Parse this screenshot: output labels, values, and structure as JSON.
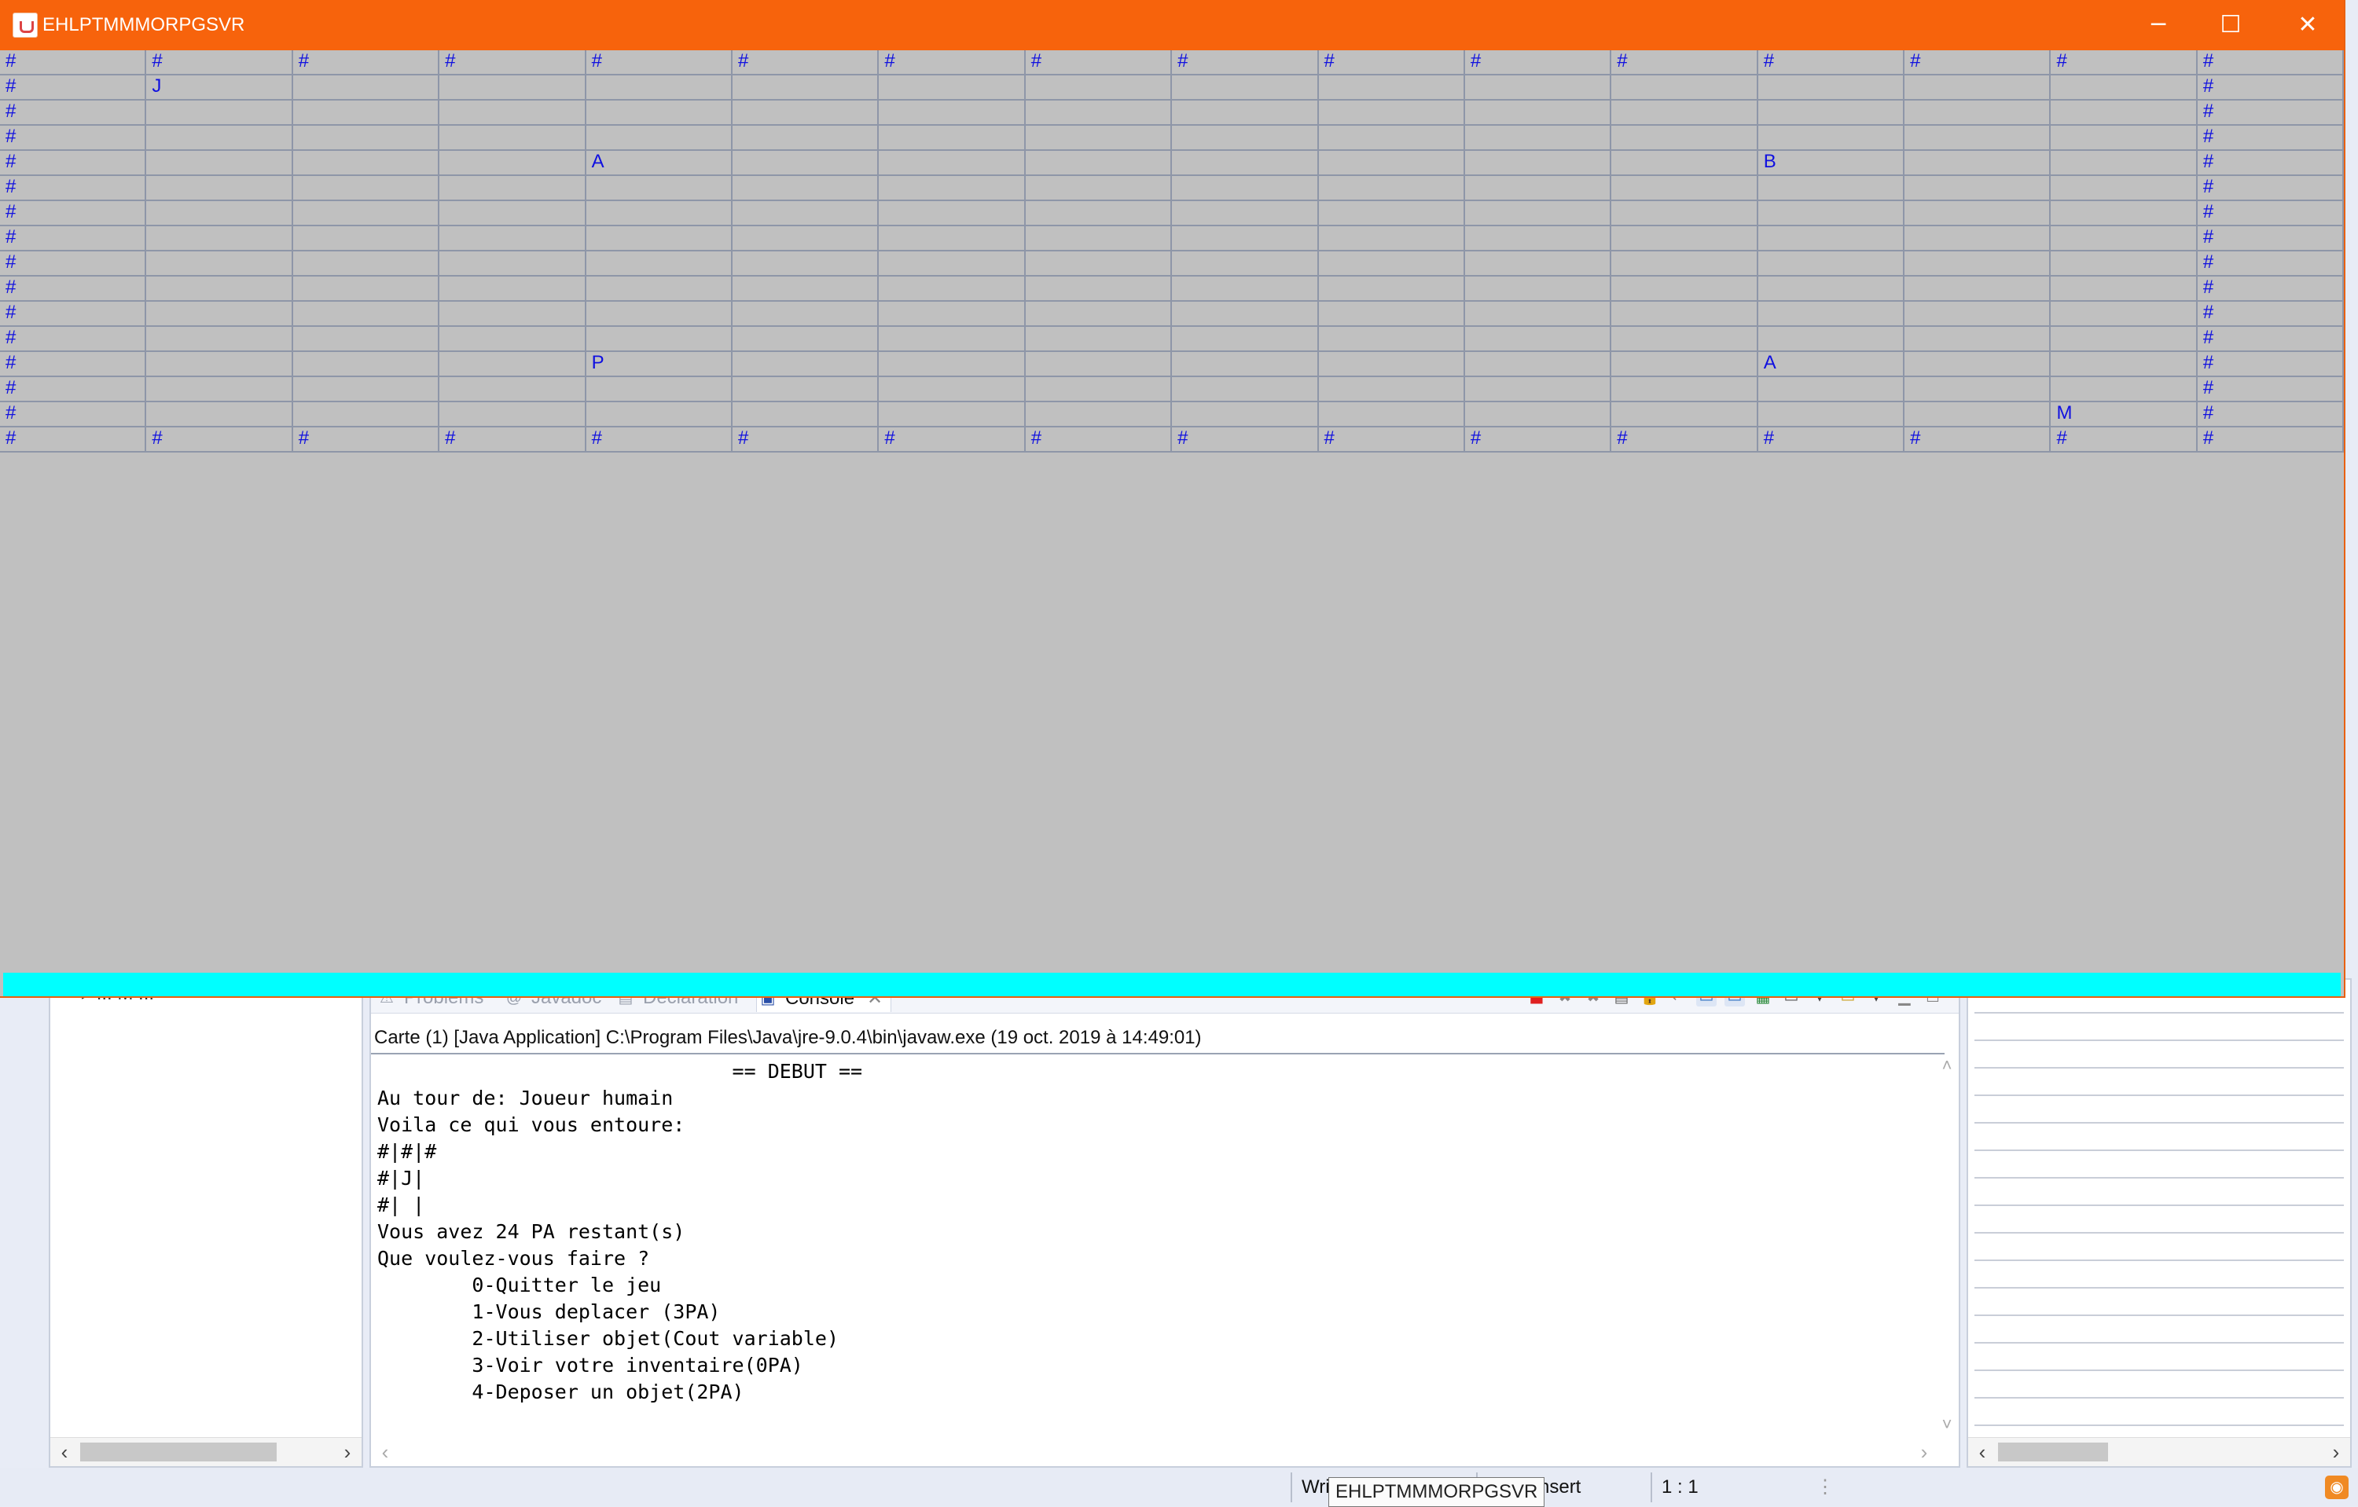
{
  "window": {
    "title": "EHLPTMMMORPGSVR",
    "controls": {
      "minimize": "─",
      "maximize": "☐",
      "close": "✕"
    }
  },
  "map": {
    "rows": [
      [
        "#",
        "#",
        "#",
        "#",
        "#",
        "#",
        "#",
        "#",
        "#",
        "#",
        "#",
        "#",
        "#",
        "#",
        "#",
        "#"
      ],
      [
        "#",
        "J",
        "",
        "",
        "",
        "",
        "",
        "",
        "",
        "",
        "",
        "",
        "",
        "",
        "",
        "#"
      ],
      [
        "#",
        "",
        "",
        "",
        "",
        "",
        "",
        "",
        "",
        "",
        "",
        "",
        "",
        "",
        "",
        "#"
      ],
      [
        "#",
        "",
        "",
        "",
        "",
        "",
        "",
        "",
        "",
        "",
        "",
        "",
        "",
        "",
        "",
        "#"
      ],
      [
        "#",
        "",
        "",
        "",
        "A",
        "",
        "",
        "",
        "",
        "",
        "",
        "",
        "B",
        "",
        "",
        "#"
      ],
      [
        "#",
        "",
        "",
        "",
        "",
        "",
        "",
        "",
        "",
        "",
        "",
        "",
        "",
        "",
        "",
        "#"
      ],
      [
        "#",
        "",
        "",
        "",
        "",
        "",
        "",
        "",
        "",
        "",
        "",
        "",
        "",
        "",
        "",
        "#"
      ],
      [
        "#",
        "",
        "",
        "",
        "",
        "",
        "",
        "",
        "",
        "",
        "",
        "",
        "",
        "",
        "",
        "#"
      ],
      [
        "#",
        "",
        "",
        "",
        "",
        "",
        "",
        "",
        "",
        "",
        "",
        "",
        "",
        "",
        "",
        "#"
      ],
      [
        "#",
        "",
        "",
        "",
        "",
        "",
        "",
        "",
        "",
        "",
        "",
        "",
        "",
        "",
        "",
        "#"
      ],
      [
        "#",
        "",
        "",
        "",
        "",
        "",
        "",
        "",
        "",
        "",
        "",
        "",
        "",
        "",
        "",
        "#"
      ],
      [
        "#",
        "",
        "",
        "",
        "",
        "",
        "",
        "",
        "",
        "",
        "",
        "",
        "",
        "",
        "",
        "#"
      ],
      [
        "#",
        "",
        "",
        "",
        "P",
        "",
        "",
        "",
        "",
        "",
        "",
        "",
        "A",
        "",
        "",
        "#"
      ],
      [
        "#",
        "",
        "",
        "",
        "",
        "",
        "",
        "",
        "",
        "",
        "",
        "",
        "",
        "",
        "",
        "#"
      ],
      [
        "#",
        "",
        "",
        "",
        "",
        "",
        "",
        "",
        "",
        "",
        "",
        "",
        "",
        "",
        "M",
        "#"
      ],
      [
        "#",
        "#",
        "#",
        "#",
        "#",
        "#",
        "#",
        "#",
        "#",
        "#",
        "#",
        "#",
        "#",
        "#",
        "#",
        "#"
      ]
    ]
  },
  "ide": {
    "left_tree_item": "▸ ... M ...",
    "tabs": [
      {
        "label": "Problems",
        "icon": "problems-icon"
      },
      {
        "label": "Javadoc",
        "icon": "at-icon"
      },
      {
        "label": "Declaration",
        "icon": "declaration-icon"
      },
      {
        "label": "Console",
        "icon": "console-icon",
        "active": true
      }
    ],
    "console": {
      "header": "Carte (1) [Java Application] C:\\Program Files\\Java\\jre-9.0.4\\bin\\javaw.exe (19 oct. 2019 à 14:49:01)",
      "lines": [
        "                              == DEBUT ==",
        "Au tour de: Joueur humain",
        "Voila ce qui vous entoure:",
        "#|#|#",
        "#|J|",
        "#| |",
        "Vous avez 24 PA restant(s)",
        "Que voulez-vous faire ?",
        "        0-Quitter le jeu",
        "        1-Vous deplacer (3PA)",
        "        2-Utiliser objet(Cout variable)",
        "        3-Voir votre inventaire(0PA)",
        "        4-Deposer un objet(2PA)"
      ]
    },
    "status": {
      "writable": "Wri",
      "insert_mode": "rt Insert",
      "position": "1 : 1",
      "tooltip": "EHLPTMMMORPGSVR"
    }
  }
}
